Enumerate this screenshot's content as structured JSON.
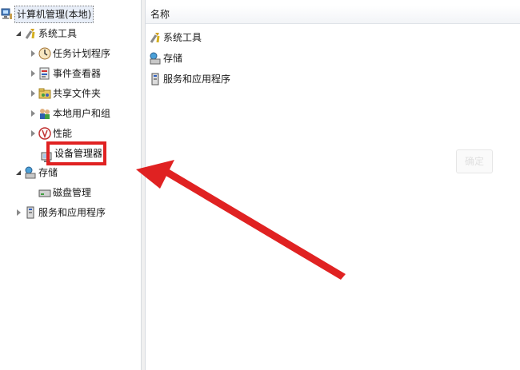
{
  "tree": {
    "root": {
      "label": "计算机管理(本地)",
      "icon": "computer-management-icon"
    },
    "system_tools": {
      "label": "系统工具",
      "icon": "tools-icon",
      "children": [
        {
          "label": "任务计划程序",
          "icon": "clock-icon"
        },
        {
          "label": "事件查看器",
          "icon": "event-viewer-icon"
        },
        {
          "label": "共享文件夹",
          "icon": "shared-folder-icon"
        },
        {
          "label": "本地用户和组",
          "icon": "users-icon"
        },
        {
          "label": "性能",
          "icon": "performance-icon"
        }
      ],
      "device_manager": {
        "label": "设备管理器",
        "icon": "device-manager-icon"
      }
    },
    "storage": {
      "label": "存储",
      "icon": "storage-icon",
      "children": [
        {
          "label": "磁盘管理",
          "icon": "disk-icon"
        }
      ]
    },
    "services": {
      "label": "服务和应用程序",
      "icon": "services-icon"
    }
  },
  "list": {
    "column_name": "名称",
    "items": [
      {
        "label": "系统工具",
        "icon": "tools-icon"
      },
      {
        "label": "存储",
        "icon": "storage-icon"
      },
      {
        "label": "服务和应用程序",
        "icon": "services-icon"
      }
    ]
  },
  "faded_button": "确定",
  "annotation": {
    "highlight_color": "#e02222"
  }
}
